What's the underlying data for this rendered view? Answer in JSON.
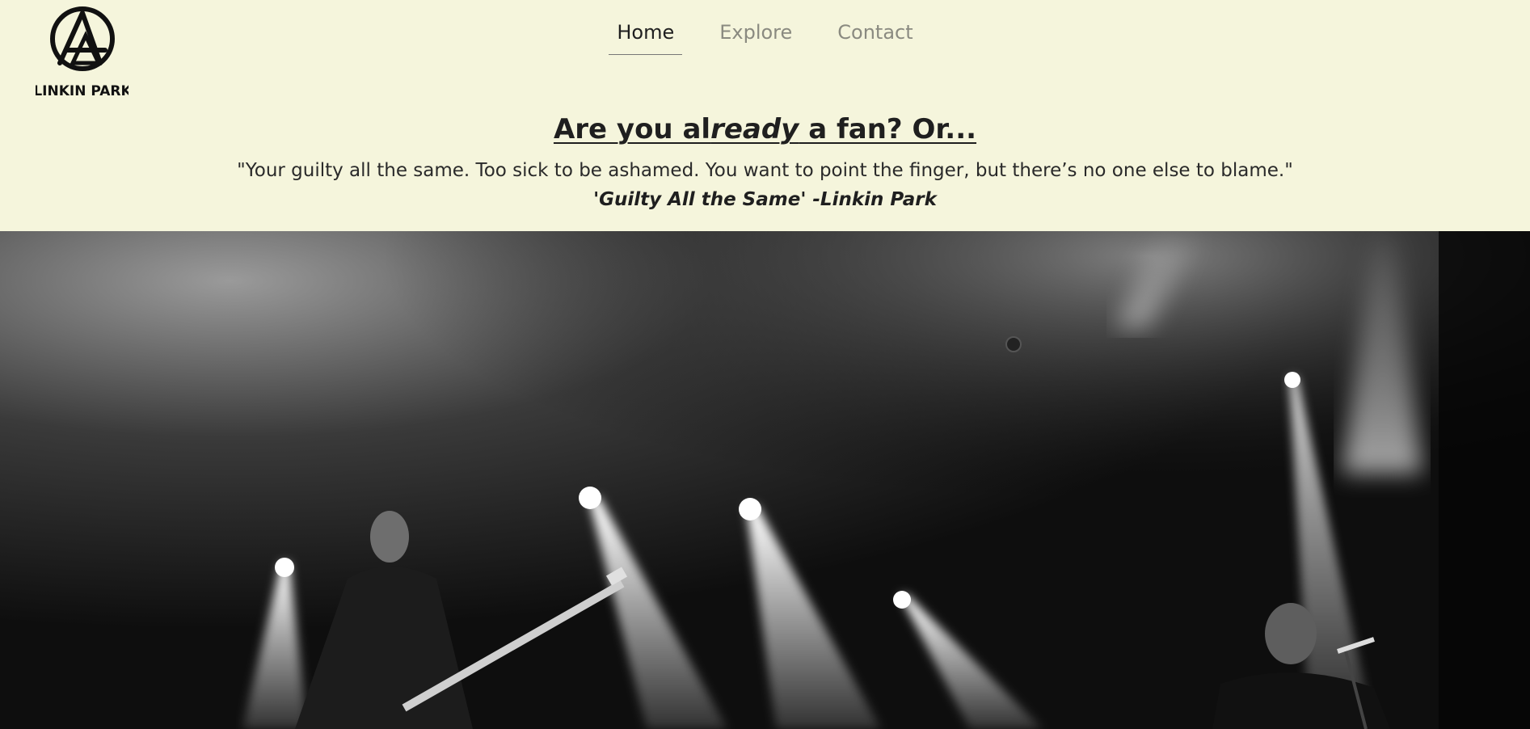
{
  "brand": {
    "logo_text": "LINKIN PARK"
  },
  "nav": {
    "items": [
      {
        "label": "Home",
        "active": true
      },
      {
        "label": "Explore",
        "active": false
      },
      {
        "label": "Contact",
        "active": false
      }
    ]
  },
  "hero_text": {
    "headline_part1": "Are you al",
    "headline_italic": "ready",
    "headline_part2": " a fan? Or...",
    "quote": "\"Your guilty all the same. Too sick to be ashamed. You want to point the finger, but there’s no one else to blame.\"",
    "attribution": "'Guilty All the Same' -Linkin Park"
  },
  "colors": {
    "header_background": "#f5f5dc",
    "active_nav": "#1f1f1f",
    "inactive_nav": "#8a8a80"
  }
}
